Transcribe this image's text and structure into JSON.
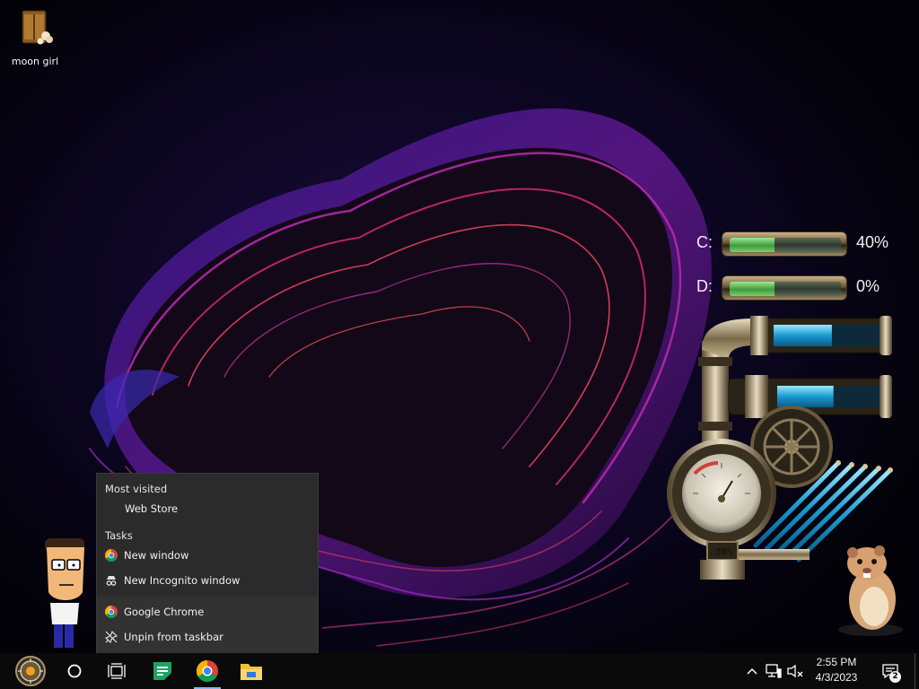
{
  "desktop": {
    "icons": [
      {
        "label": "moon girl",
        "icon": "chest-icon"
      }
    ]
  },
  "drives": [
    {
      "letter": "C:",
      "percent_text": "40%",
      "used_fraction": 0.4
    },
    {
      "letter": "D:",
      "percent_text": "0%",
      "used_fraction": 0.4
    }
  ],
  "gadget": {
    "gauge_percent": "58%",
    "meter_fractions": [
      0.55,
      0.55
    ]
  },
  "jump_list": {
    "most_visited_header": "Most visited",
    "most_visited": [
      {
        "label": "Web Store"
      }
    ],
    "tasks_header": "Tasks",
    "tasks": [
      {
        "label": "New window",
        "icon": "chrome-icon"
      },
      {
        "label": "New Incognito window",
        "icon": "incognito-icon"
      }
    ],
    "app": {
      "label": "Google Chrome",
      "icon": "chrome-icon"
    },
    "unpin": {
      "label": "Unpin from taskbar",
      "icon": "unpin-icon"
    }
  },
  "taskbar": {
    "apps": [
      "start-gear-icon",
      "cortana-circle-icon",
      "task-view-icon",
      "sheets-icon",
      "chrome-icon",
      "file-explorer-icon"
    ],
    "tray": [
      "chevron-up-icon",
      "network-icon",
      "volume-muted-icon"
    ],
    "time": "2:55 PM",
    "date": "4/3/2023",
    "notification_count": "2"
  },
  "colors": {
    "taskbar_bg": "#0a0a0a",
    "jumplist_bg": "#2b2b2b",
    "accent_blue": "#8ab4ff",
    "drive_fill": "#3d9c3a"
  }
}
